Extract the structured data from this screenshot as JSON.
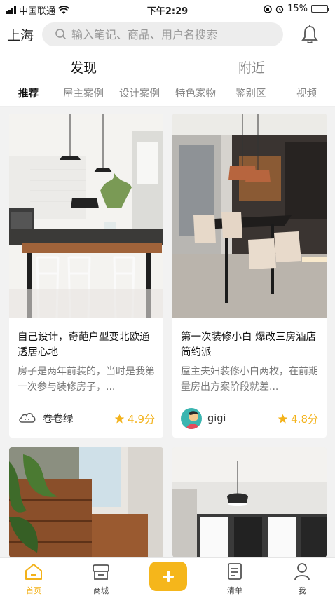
{
  "status_bar": {
    "carrier": "中国联通",
    "time": "下午2:29",
    "battery": "15%",
    "battery_level": 0.15
  },
  "header": {
    "city": "上海",
    "search_placeholder": "输入笔记、商品、用户名搜索",
    "icons": [
      "search-icon",
      "bell-icon"
    ]
  },
  "main_tabs": [
    {
      "label": "发现",
      "active": true
    },
    {
      "label": "附近",
      "active": false
    }
  ],
  "sub_tabs": [
    {
      "label": "推荐",
      "active": true
    },
    {
      "label": "屋主案例"
    },
    {
      "label": "设计案例"
    },
    {
      "label": "特色家物"
    },
    {
      "label": "鉴别区"
    },
    {
      "label": "视频"
    }
  ],
  "cards": [
    {
      "title": "自己设计，奇葩户型变北欧通透居心地",
      "desc": "房子是两年前装的，当时是我第一次参与装修房子，...",
      "author": "卷卷绿",
      "rating": "4.9分"
    },
    {
      "title": "第一次装修小白 爆改三房酒店简约派",
      "desc": "屋主夫妇装修小白两枚，在前期量房出方案阶段就差...",
      "author": "gigi",
      "rating": "4.8分"
    }
  ],
  "bottom_nav": [
    {
      "label": "首页",
      "icon": "home-icon",
      "active": true
    },
    {
      "label": "商城",
      "icon": "shop-icon"
    },
    {
      "label": "",
      "icon": "plus-icon"
    },
    {
      "label": "清单",
      "icon": "checklist-icon"
    },
    {
      "label": "我",
      "icon": "user-icon"
    }
  ],
  "colors": {
    "accent": "#f5b61b",
    "rating": "#f3b21a",
    "battery_low": "#e0322f"
  }
}
